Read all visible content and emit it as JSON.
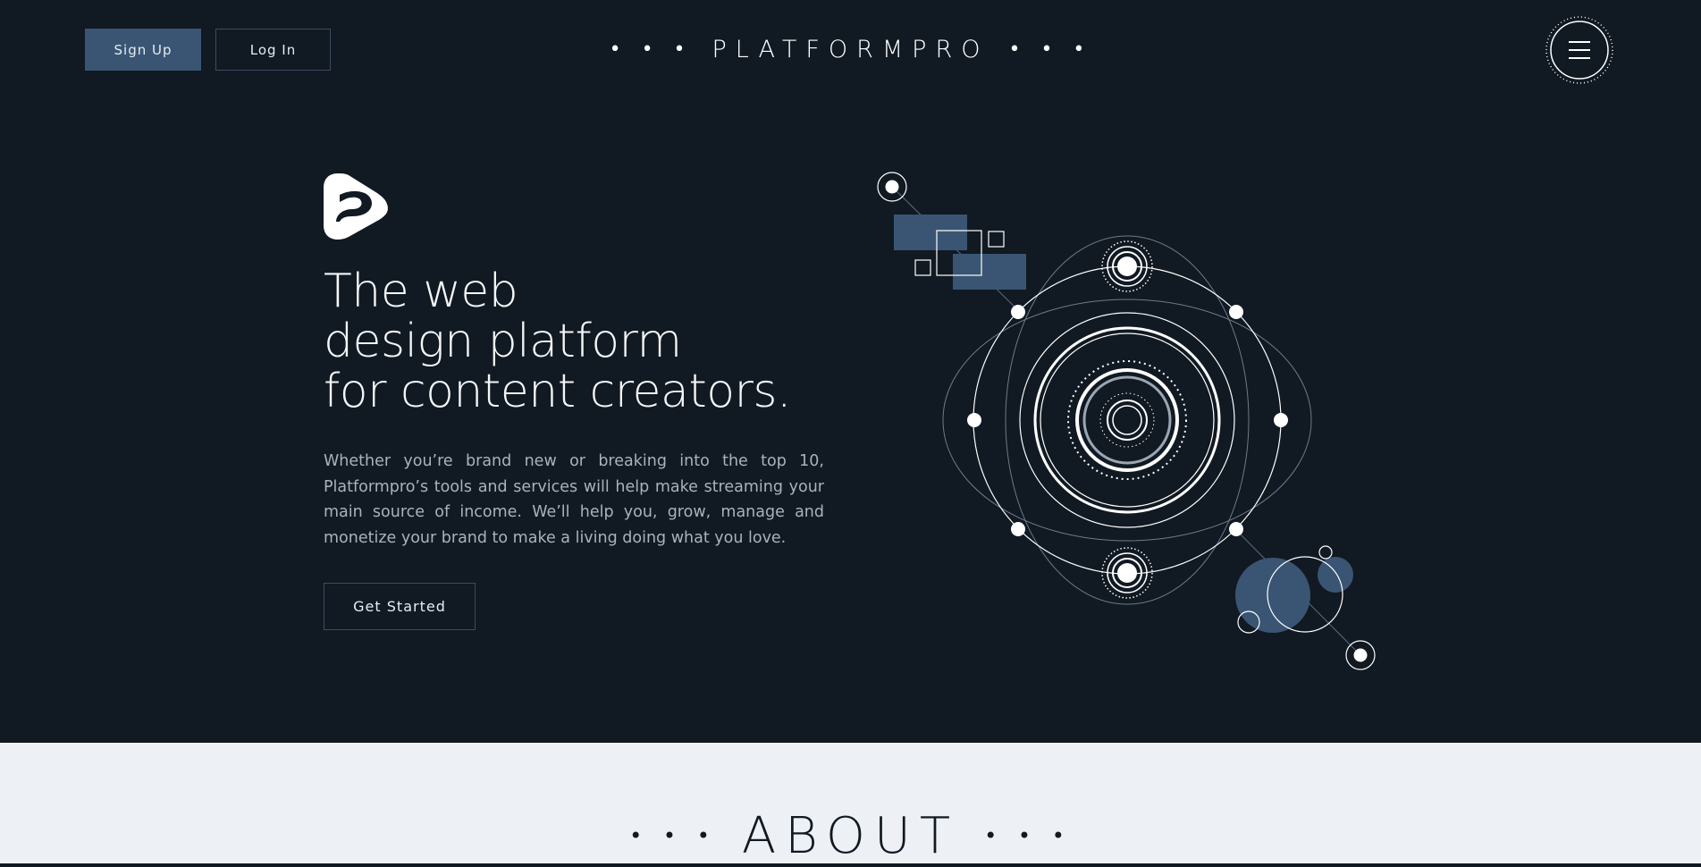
{
  "header": {
    "signup_label": "Sign Up",
    "login_label": "Log In",
    "brand_dots": "• • •",
    "brand_name": "PLATFORMPRO",
    "menu_icon": "hamburger-menu-icon"
  },
  "hero": {
    "logo_icon": "platformpro-logo-icon",
    "title_lines": [
      "The web",
      "design platform",
      "for content creators."
    ],
    "description": "Whether you’re brand new or breaking into the top 10, Platformpro’s tools and services will help make streaming your main source of income. We’ll help you, grow, manage and monetize your brand to make a living doing what you love.",
    "cta_label": "Get Started"
  },
  "about": {
    "dots": "• • •",
    "heading": "ABOUT"
  },
  "colors": {
    "background": "#111922",
    "accent": "#3a5573",
    "about_background": "#edf1f5"
  }
}
